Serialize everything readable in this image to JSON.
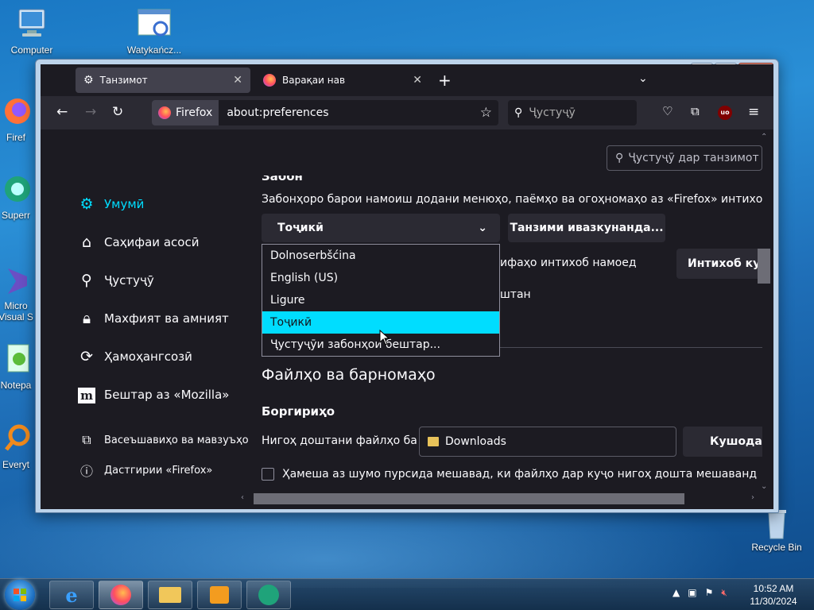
{
  "desktop": {
    "icons": [
      {
        "label": "Computer"
      },
      {
        "label": "Watykańcz..."
      },
      {
        "label": "Firef"
      },
      {
        "label": "Superr"
      },
      {
        "label": "Micro Visual S"
      },
      {
        "label": "Notepa"
      },
      {
        "label": "Everyt"
      }
    ],
    "recycle_bin": "Recycle Bin"
  },
  "browser": {
    "tabs": [
      {
        "label": "Танзимот",
        "icon": "gear-icon",
        "active": true
      },
      {
        "label": "Варақаи нав",
        "icon": "firefox-icon",
        "active": false
      }
    ],
    "new_tab": "+",
    "identity_label": "Firefox",
    "url": "about:preferences",
    "search_placeholder": "Ҷустуҷӯ"
  },
  "preferences": {
    "search_placeholder": "Ҷустуҷӯ дар танзимот",
    "sidebar": [
      {
        "label": "Умумӣ",
        "icon": "gear-icon",
        "active": true
      },
      {
        "label": "Саҳифаи асосӣ",
        "icon": "home-icon"
      },
      {
        "label": "Ҷустуҷӯ",
        "icon": "search-icon"
      },
      {
        "label": "Махфият ва амният",
        "icon": "lock-icon"
      },
      {
        "label": "Ҳамоҳангсозӣ",
        "icon": "sync-icon"
      },
      {
        "label": "Бештар аз «Mozilla»",
        "icon": "mozilla-icon"
      }
    ],
    "sidebar_footer": [
      {
        "label": "Васеъшавиҳо ва мавзуъҳо",
        "icon": "puzzle-icon"
      },
      {
        "label": "Дастгирии «Firefox»",
        "icon": "help-icon"
      }
    ],
    "language": {
      "heading": "Забон",
      "description": "Забонҳоро барои намоиш додани менюҳо, паёмҳо ва огоҳномаҳо аз «Firefox» интихоб н",
      "selected": "Тоҷикӣ",
      "alternatives_button": "Танзими ивазкунанда...",
      "partial_text1": "ифаҳо интихоб намоед",
      "choose_button": "Интихоб кун",
      "partial_text2": "штан",
      "options": [
        "Dolnoserbšćina",
        "English (US)",
        "Ligure",
        "Тоҷикӣ",
        "Ҷустуҷӯи забонҳои бештар..."
      ],
      "highlighted_index": 3
    },
    "files": {
      "heading": "Файлҳо ва барномаҳо",
      "downloads_heading": "Боргириҳо",
      "save_label": "Нигоҳ доштани файлҳо ба",
      "downloads_folder": "Downloads",
      "browse_button": "Кушодан",
      "always_ask": "Ҳамеша аз шумо пурсида мешавад, ки файлҳо дар куҷо нигоҳ дошта мешаванд"
    }
  },
  "taskbar": {
    "time": "10:52 AM",
    "date": "11/30/2024"
  }
}
